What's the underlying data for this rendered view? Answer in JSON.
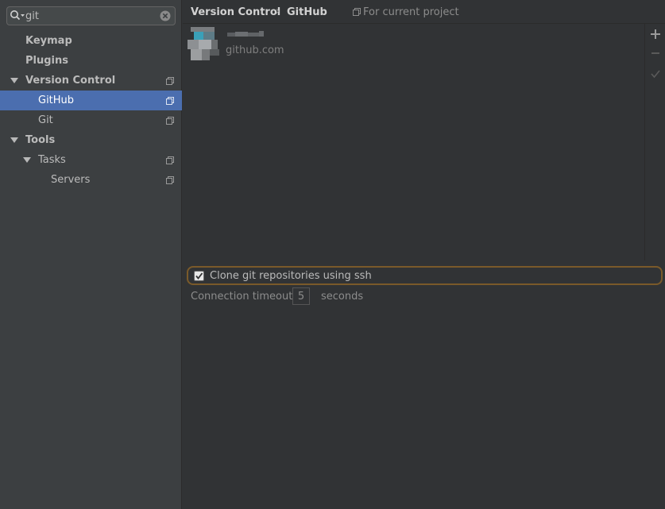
{
  "search": {
    "value": "git"
  },
  "tree": {
    "keymap": "Keymap",
    "plugins": "Plugins",
    "version_control": "Version Control",
    "github": "GitHub",
    "git": "Git",
    "tools": "Tools",
    "tasks": "Tasks",
    "servers": "Servers"
  },
  "breadcrumb": {
    "parent": "Version Control",
    "separator": "›",
    "current": "GitHub",
    "scope": "For current project"
  },
  "accounts": [
    {
      "server": "github.com"
    }
  ],
  "settings": {
    "clone_ssh_label": "Clone git repositories using ssh",
    "clone_ssh_checked": true,
    "timeout_label": "Connection timeout:",
    "timeout_value": "5",
    "timeout_unit": "seconds"
  },
  "colors": {
    "selection": "#4b6eaf",
    "sidebar_bg": "#3c3f41",
    "panel_bg": "#313335",
    "focus_ring": "#7a5a2a"
  }
}
